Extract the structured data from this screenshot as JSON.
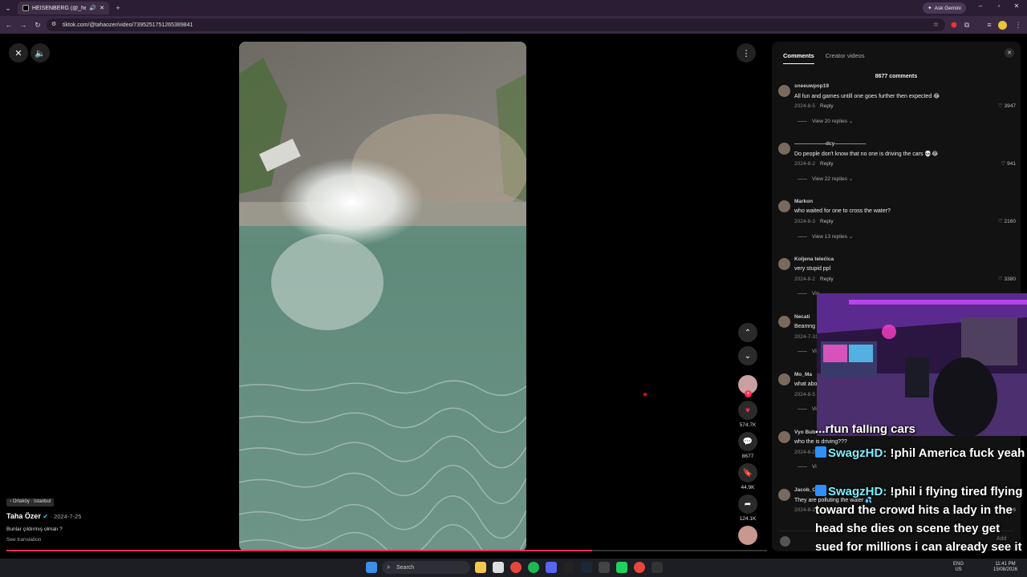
{
  "browser": {
    "tab_title": "HEISENBERG (@_heisenbe",
    "url": "tiktok.com/@tahaozer/video/7395251751265389841",
    "ask_label": "Ask Gemini",
    "new_tab": "+"
  },
  "video": {
    "location": "Ortaköy · Istanbul",
    "author": "Taha Özer",
    "date": "· 2024-7-25",
    "caption": "Bunlar çıldırmış olmalı ?",
    "see_translation": "See translation",
    "progress": 0.77
  },
  "actions": {
    "likes": "574.7K",
    "comments": "8677",
    "saves": "44.9K",
    "shares": "124.1K"
  },
  "panel": {
    "tab_comments": "Comments",
    "tab_creator": "Creator videos",
    "count": "8677 comments",
    "comments": [
      {
        "user": "sneeuwpop19",
        "text": "All fun and games untill one goes further then expected 😂",
        "date": "2024-8-5",
        "reply": "Reply",
        "likes": "3947",
        "replies": "View 20 replies ⌄"
      },
      {
        "user": "——————dcy——————",
        "text": "Do people don't know that no one is driving the cars 💀😂",
        "date": "2024-8-2",
        "reply": "Reply",
        "likes": "941",
        "replies": "View 22 replies ⌄"
      },
      {
        "user": "Markon",
        "text": "who waited for one to cross the water?",
        "date": "2024-8-3",
        "reply": "Reply",
        "likes": "2160",
        "replies": "View 13 replies ⌄"
      },
      {
        "user": "Koljena telećica",
        "text": "very stupid ppl",
        "date": "2024-8-2",
        "reply": "Reply",
        "likes": "3380",
        "replies": "Vie"
      },
      {
        "user": "Necati",
        "text": "Beamng",
        "date": "2024-7-31",
        "reply": "",
        "likes": "",
        "replies": "Vie"
      },
      {
        "user": "Mo_Ma",
        "text": "what abo",
        "date": "2024-8-5",
        "reply": "",
        "likes": "",
        "replies": "Vie"
      },
      {
        "user": "Vyo Bubu",
        "text": "who the is driving???",
        "date": "2024-8-2",
        "reply": "",
        "likes": "7",
        "replies": "Vi"
      },
      {
        "user": "Jacob_Co",
        "text": "They are polluting the water 💦",
        "date": "2024-8-2",
        "reply": "",
        "likes": "196",
        "replies": ""
      }
    ],
    "add_placeholder": "Add"
  },
  "chat": {
    "lines": [
      {
        "name": "",
        "msg": "...rfun falling cars"
      },
      {
        "name": "SwagzHD:",
        "msg": " !phil America fuck yeah"
      },
      {
        "name": "SwagzHD:",
        "msg": " !phil i flying tired flying toward the crowd hits a lady in the head she dies on scene they get sued for millions i can already see it"
      }
    ]
  },
  "taskbar": {
    "search": "Search",
    "lang_top": "ENG",
    "lang_bottom": "US",
    "time": "11:41 PM",
    "date": "15/08/2026"
  },
  "colors": {
    "accent": "#fe2c55",
    "chat_name": "#7cf0ff"
  }
}
